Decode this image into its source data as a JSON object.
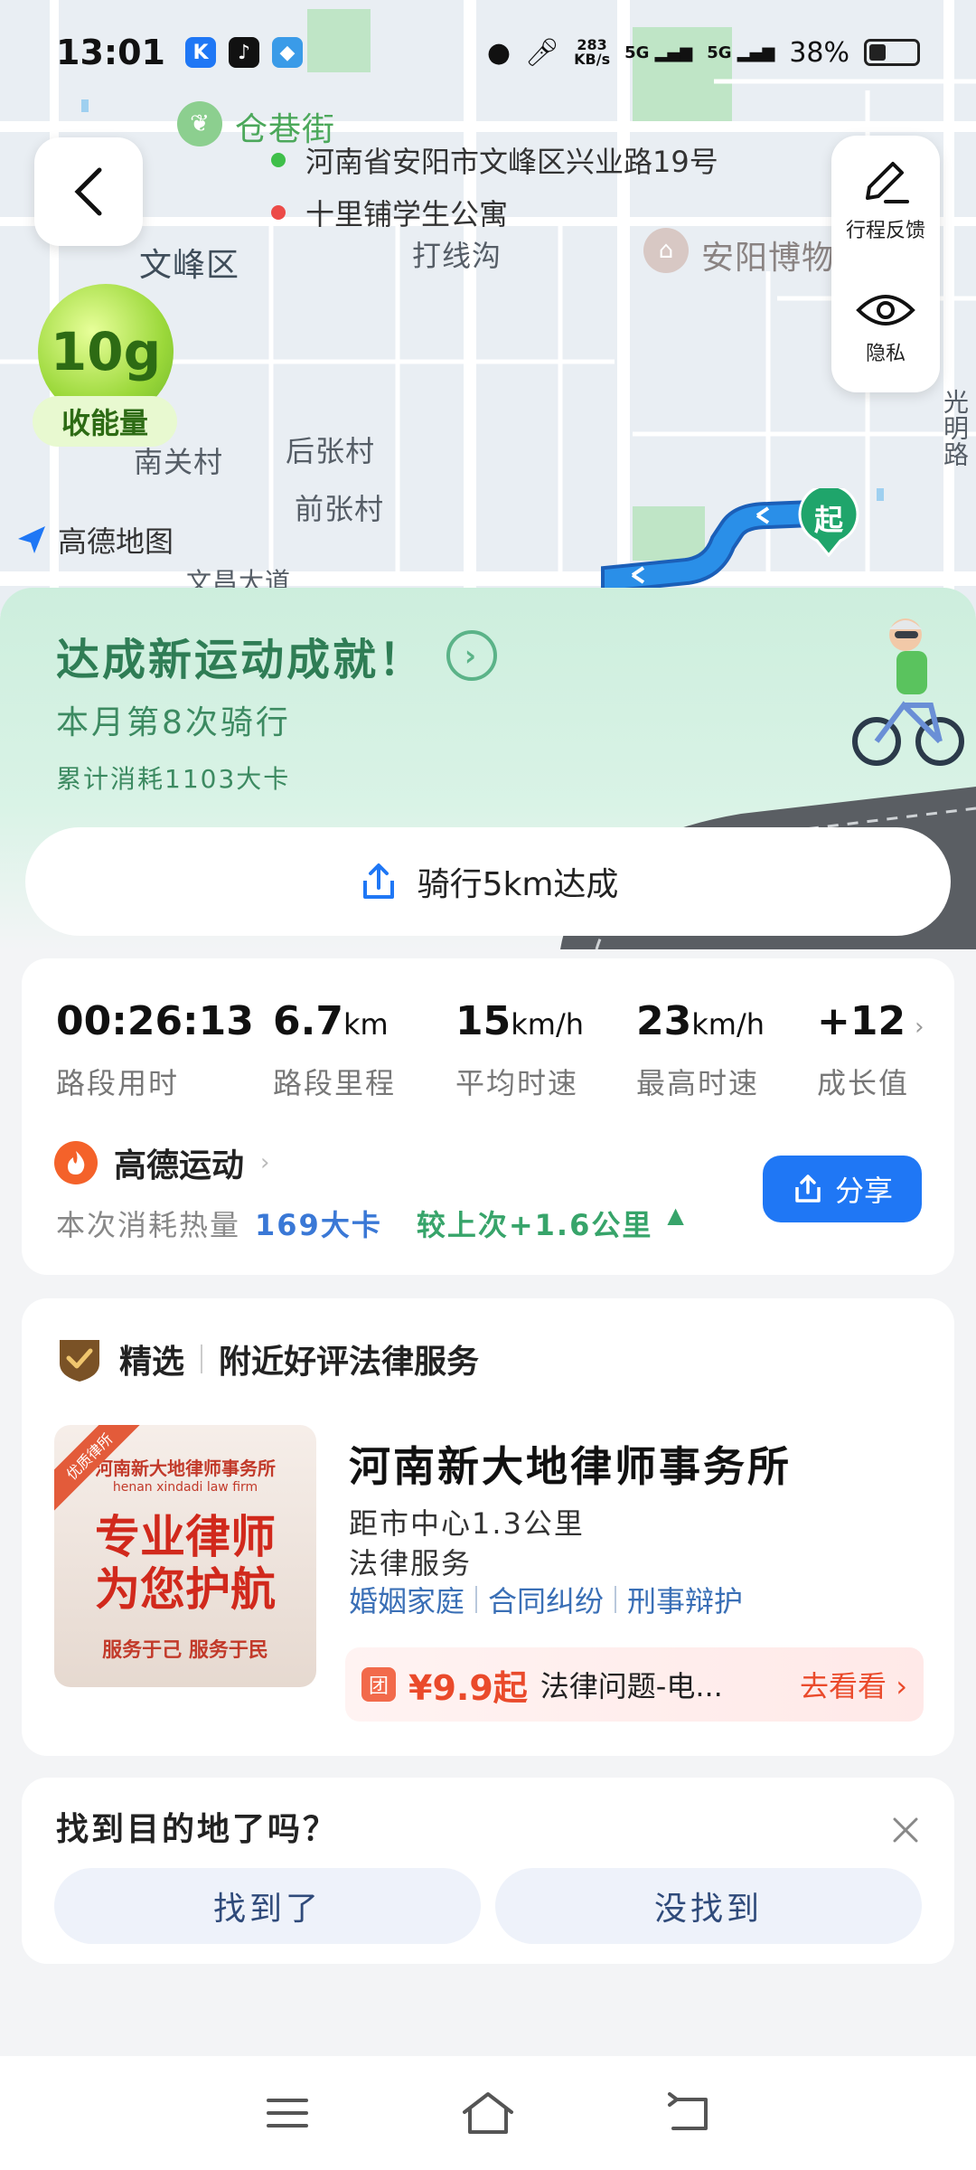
{
  "status_bar": {
    "time": "13:01",
    "net_speed_value": "283",
    "net_speed_unit": "KB/s",
    "sig1": "5G",
    "sig2": "5G",
    "battery": "38%"
  },
  "map": {
    "labels": {
      "cangxiangjie": "仓巷街",
      "wenfengqu": "文峰区",
      "daxiangou": "打线沟",
      "museum": "安阳博物",
      "nanguancun": "南关村",
      "houzhangcun": "后张村",
      "qianzhangcun": "前张村",
      "wenchang": "文昌大道",
      "guangming": "光明路"
    },
    "route": {
      "origin": "河南省安阳市文峰区兴业路19号",
      "destination": "十里铺学生公寓"
    },
    "controls": {
      "feedback_label": "行程反馈",
      "privacy_label": "隐私"
    },
    "energy": {
      "value": "10g",
      "tag": "收能量"
    },
    "logo_text": "高德地图",
    "start_pin_label": "起"
  },
  "achievement": {
    "title": "达成新运动成就！",
    "subtitle": "本月第8次骑行",
    "small": "累计消耗1103大卡",
    "button_label": "骑行5km达成"
  },
  "stats": {
    "items": [
      {
        "value": "00:26:13",
        "unit": "",
        "label": "路段用时"
      },
      {
        "value": "6.7",
        "unit": "km",
        "label": "路段里程"
      },
      {
        "value": "15",
        "unit": "km/h",
        "label": "平均时速"
      },
      {
        "value": "23",
        "unit": "km/h",
        "label": "最高时速"
      },
      {
        "value": "+12",
        "unit": "",
        "label": "成长值"
      }
    ],
    "sport_name": "高德运动",
    "cal_prefix": "本次消耗热量",
    "cal_value": "169大卡",
    "compare": "较上次+1.6公里",
    "share_label": "分享"
  },
  "legal": {
    "badge": "精选",
    "heading": "附近好评法律服务",
    "ad": {
      "ribbon": "优质律所",
      "top": "河南新大地律师事务所",
      "sub": "henan xindadi law firm",
      "main_line1": "专业律师",
      "main_line2": "为您护航",
      "bottom": "服务于己 服务于民"
    },
    "firm_name": "河南新大地律师事务所",
    "distance": "距市中心1.3公里",
    "category": "法律服务",
    "tags": [
      "婚姻家庭",
      "合同纠纷",
      "刑事辩护"
    ],
    "deal": {
      "icon": "团",
      "price": "¥9.9起",
      "desc": "法律问题-电...",
      "go": "去看看"
    }
  },
  "feedback": {
    "question": "找到目的地了吗？",
    "found": "找到了",
    "not_found": "没找到"
  },
  "colors": {
    "accent_blue": "#1f77f5",
    "achievement_green": "#2f7d55",
    "deal_red": "#ea4a2b",
    "route_blue": "#2a8fe8"
  }
}
